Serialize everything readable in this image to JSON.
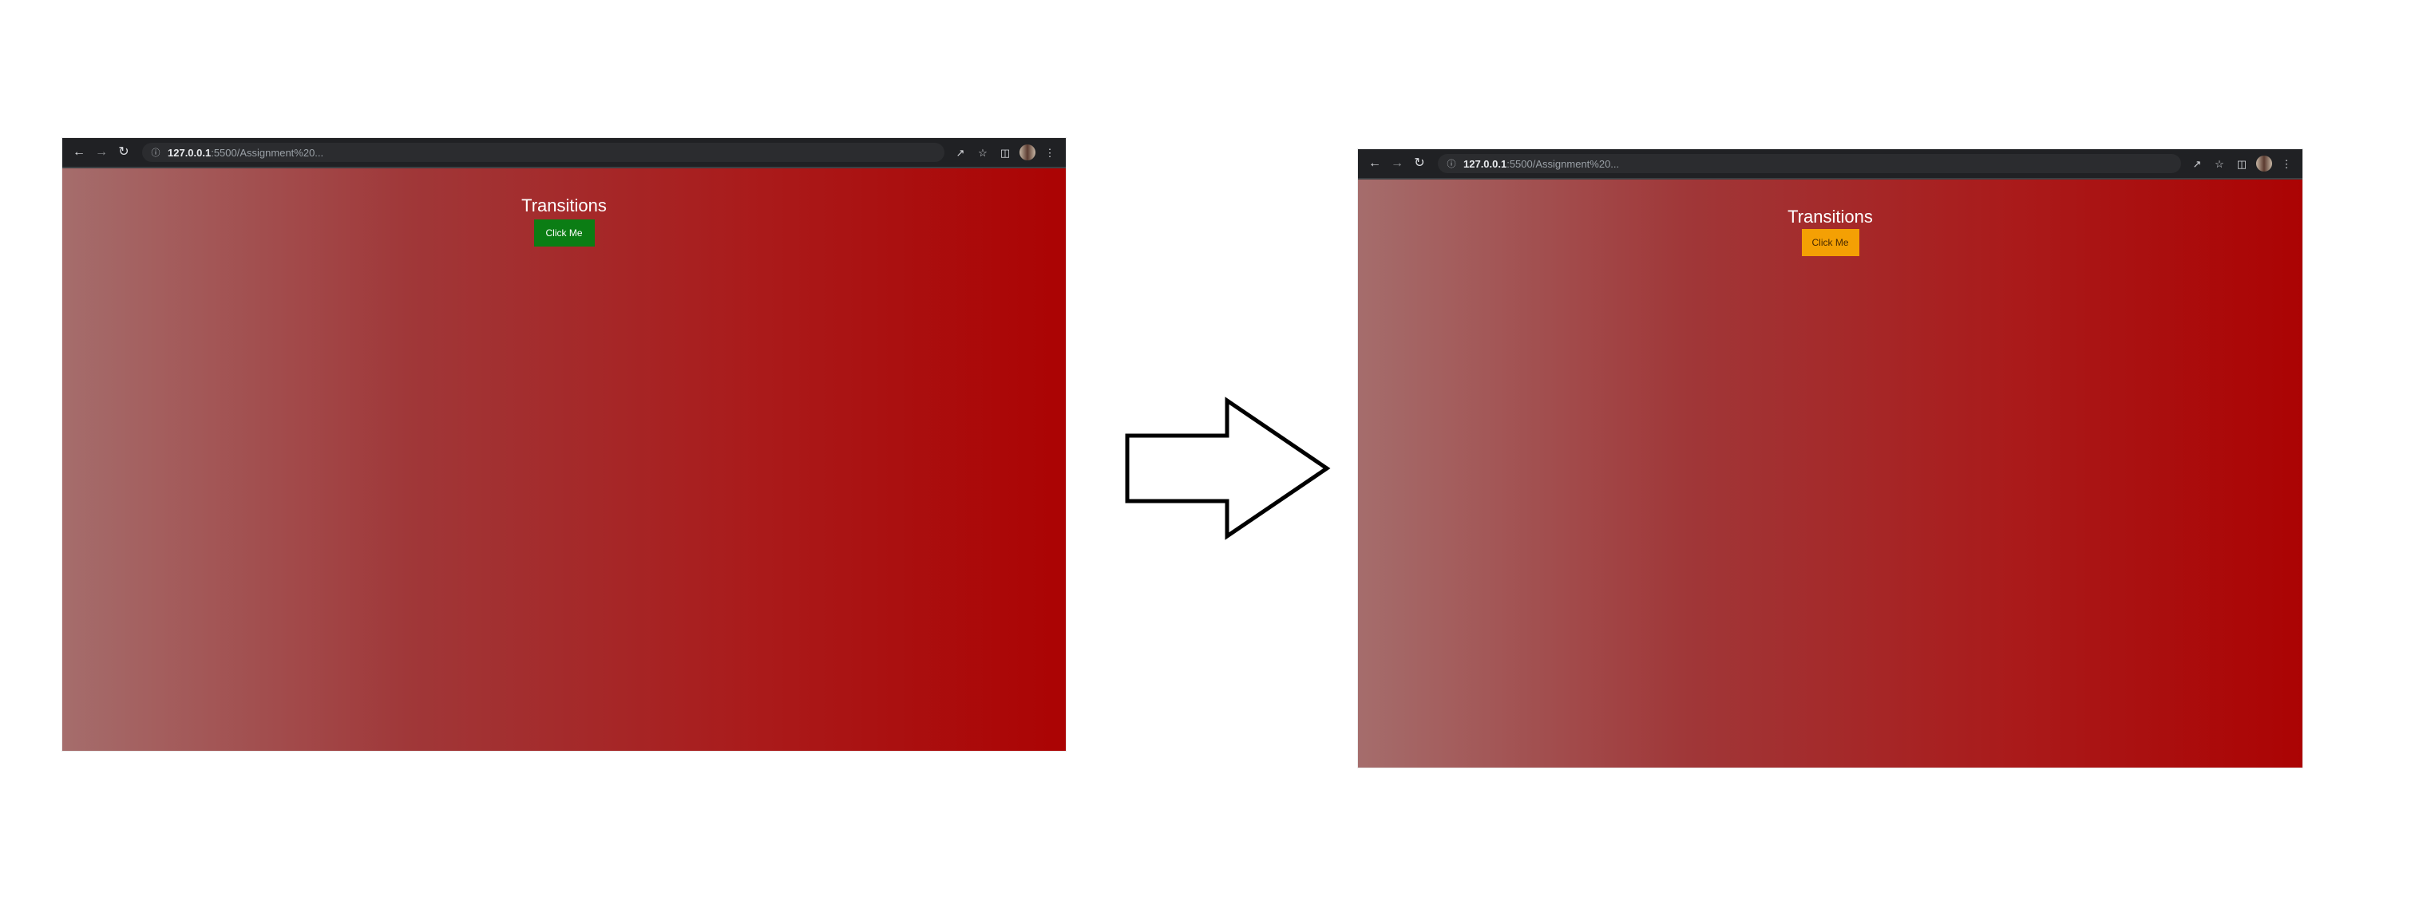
{
  "before": {
    "url_host": "127.0.0.1",
    "url_path": ":5500/Assignment%20...",
    "page_title": "Transitions",
    "button_label": "Click Me",
    "button_color": "#0b7d14"
  },
  "after": {
    "url_host": "127.0.0.1",
    "url_path": ":5500/Assignment%20...",
    "page_title": "Transitions",
    "button_label": "Click Me",
    "button_color": "#f4a004"
  },
  "icons": {
    "back": "arrow-left-icon",
    "forward": "arrow-right-icon",
    "reload": "reload-icon",
    "site_info": "info-icon",
    "share": "share-icon",
    "bookmark": "star-icon",
    "side_panel": "side-panel-icon",
    "menu": "kebab-menu-icon",
    "arrow": "right-arrow-icon"
  },
  "colors": {
    "gradient_start": "#a56d6c",
    "gradient_end": "#ab0303",
    "toolbar": "#202124"
  }
}
